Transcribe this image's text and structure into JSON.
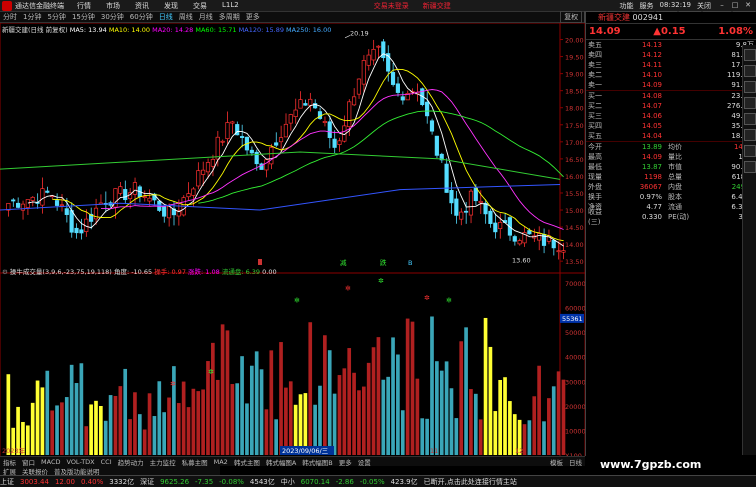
{
  "app": {
    "title": "通达信金融终端",
    "menu": [
      "行情",
      "市场",
      "资讯",
      "发现",
      "交易",
      "L1L2"
    ],
    "alert1": "交易未登录",
    "alert2": "新疆交建",
    "right_menu": [
      "功能",
      "服务",
      "08:32:19",
      "关闭"
    ]
  },
  "periods": [
    {
      "label": "分时",
      "on": false
    },
    {
      "label": "1分钟",
      "on": false
    },
    {
      "label": "5分钟",
      "on": false
    },
    {
      "label": "15分钟",
      "on": false
    },
    {
      "label": "30分钟",
      "on": false
    },
    {
      "label": "60分钟",
      "on": false
    },
    {
      "label": "日线",
      "on": true
    },
    {
      "label": "周线",
      "on": false
    },
    {
      "label": "月线",
      "on": false
    },
    {
      "label": "多周期",
      "on": false
    },
    {
      "label": "更多",
      "on": false
    }
  ],
  "tools": [
    "复权",
    "叠加",
    "统计",
    "画线",
    "F10",
    "标记",
    "+自选",
    "返回"
  ],
  "chart_title": "新疆交建(日线 前复权)",
  "ma": [
    {
      "label": "MA5: 13.94",
      "color": "#ffffff"
    },
    {
      "label": "MA10: 14.00",
      "color": "#ffff00"
    },
    {
      "label": "MA20: 14.28",
      "color": "#ff00ff"
    },
    {
      "label": "MA60: 15.71",
      "color": "#00ff00"
    },
    {
      "label": "MA120: 15.89",
      "color": "#4466ff"
    },
    {
      "label": "MA250: 16.00",
      "color": "#44aaff"
    }
  ],
  "indicator": {
    "name": "操牛成交量(3,9,6,-23,75,19,118)",
    "items": [
      {
        "label": "角度: -10.65",
        "color": "#ddd"
      },
      {
        "label": "操手: 0.97",
        "color": "#f33"
      },
      {
        "label": "涨跌: 1.08",
        "color": "#ff00ff"
      },
      {
        "label": "流通盘: 6.39",
        "color": "#3c3"
      },
      {
        "label": "0.00",
        "color": "#ddd"
      }
    ]
  },
  "price_axis": [
    "20.00",
    "19.50",
    "19.00",
    "18.50",
    "18.00",
    "17.50",
    "17.00",
    "16.50",
    "16.00",
    "15.50",
    "15.00",
    "14.50",
    "14.00",
    "13.50"
  ],
  "vol_axis": [
    "70000",
    "60000",
    "50000",
    "40000",
    "30000",
    "20000",
    "10000",
    "X100"
  ],
  "vol_tag": "55361",
  "high_label": "20.19",
  "low_label": "13.60",
  "signals": [
    "减",
    "跌",
    "B"
  ],
  "date_label": "2023/09/06/三",
  "year_label": "2023年",
  "x_labels": [
    "11",
    "12"
  ],
  "stock": {
    "code": "002941",
    "name": "新疆交建",
    "price": "14.09",
    "change": "▲0.15",
    "pct": "1.08%"
  },
  "asks": [
    {
      "label": "卖五",
      "price": "14.13",
      "vol": "9.8万"
    },
    {
      "label": "卖四",
      "price": "14.12",
      "vol": "81.3万"
    },
    {
      "label": "卖三",
      "price": "14.11",
      "vol": "17.2万"
    },
    {
      "label": "卖二",
      "price": "14.10",
      "vol": "119.7万"
    },
    {
      "label": "卖一",
      "price": "14.09",
      "vol": "91.2万"
    }
  ],
  "bids": [
    {
      "label": "买一",
      "price": "14.08",
      "vol": "23.7万"
    },
    {
      "label": "买二",
      "price": "14.07",
      "vol": "276.8万"
    },
    {
      "label": "买三",
      "price": "14.06",
      "vol": "49.2万"
    },
    {
      "label": "买四",
      "price": "14.05",
      "vol": "35.7万"
    },
    {
      "label": "买五",
      "price": "14.04",
      "vol": "18.2万"
    }
  ],
  "info": [
    {
      "a": "今开",
      "b": "13.89",
      "bc": "g",
      "c": "均价",
      "d": "14.01",
      "dc": "r"
    },
    {
      "a": "最高",
      "b": "14.09",
      "bc": "r",
      "c": "量比",
      "d": "1.08",
      "dc": "w"
    },
    {
      "a": "最低",
      "b": "13.87",
      "bc": "g",
      "c": "市值",
      "d": "90.9亿",
      "dc": "w"
    },
    {
      "a": "现量",
      "b": "1198",
      "bc": "r",
      "c": "总量",
      "d": "61814",
      "dc": "w"
    },
    {
      "a": "外盘",
      "b": "36067",
      "bc": "r",
      "c": "内盘",
      "d": "24947",
      "dc": "g"
    },
    {
      "a": "换手",
      "b": "0.97%",
      "bc": "w",
      "c": "股本",
      "d": "6.45亿",
      "dc": "w"
    },
    {
      "a": "净资",
      "b": "4.77",
      "bc": "w",
      "c": "流通",
      "d": "6.39亿",
      "dc": "w"
    },
    {
      "a": "收益(三)",
      "b": "0.330",
      "bc": "w",
      "c": "PE(动)",
      "d": "31.7",
      "dc": "w"
    }
  ],
  "tabs1": [
    "指标",
    "窗口",
    "MACD",
    "VOL-TDX",
    "CCI",
    "趋势动力",
    "主力监控",
    "私募主图",
    "MA2",
    "韩式主图",
    "韩式幅图A",
    "韩式幅图B",
    "更多",
    "设置"
  ],
  "tabs1_right": [
    "模板",
    "日线"
  ],
  "tabs2": [
    "扩展",
    "关联报价",
    "普及版功能说明"
  ],
  "status": [
    {
      "t": "上证",
      "c": "w"
    },
    {
      "t": "3003.44",
      "c": "r"
    },
    {
      "t": "12.00",
      "c": "r"
    },
    {
      "t": "0.40%",
      "c": "r"
    },
    {
      "t": "3332亿",
      "c": "w"
    },
    {
      "t": "深证",
      "c": "w"
    },
    {
      "t": "9625.26",
      "c": "g"
    },
    {
      "t": "-7.35",
      "c": "g"
    },
    {
      "t": "-0.08%",
      "c": "g"
    },
    {
      "t": "4543亿",
      "c": "w"
    },
    {
      "t": "中小",
      "c": "w"
    },
    {
      "t": "6070.14",
      "c": "g"
    },
    {
      "t": "-2.86",
      "c": "g"
    },
    {
      "t": "-0.05%",
      "c": "g"
    },
    {
      "t": "423.9亿",
      "c": "w"
    },
    {
      "t": "已断开,点击此处连接行情主站",
      "c": "w"
    }
  ],
  "watermark": "www.7gpzb.com"
}
